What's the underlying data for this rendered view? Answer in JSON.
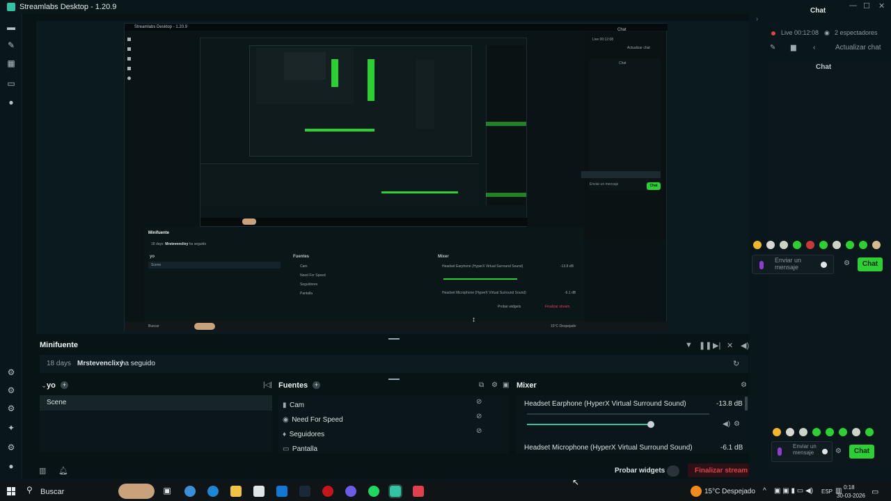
{
  "titlebar": {
    "title": "Streamlabs Desktop - 1.20.9",
    "min": "—",
    "max": "☐",
    "close": "✕"
  },
  "right_panel": {
    "header": "Chat",
    "live": "Live 00:12:08",
    "viewers": "2 espectadores",
    "update_chat": "Actualizar chat",
    "chat_title": "Chat",
    "send_placeholder": "Enviar un mensaje",
    "chat_button": "Chat"
  },
  "minifuente": {
    "title": "Minifuente",
    "event_days": "18 days",
    "event_user": "Mrstevenclixy",
    "event_action": "ha seguido"
  },
  "scenes": {
    "title": "yo",
    "items": [
      "Scene"
    ]
  },
  "sources": {
    "title": "Fuentes",
    "items": [
      "Cam",
      "Need For Speed",
      "Seguidores",
      "Pantalla"
    ]
  },
  "mixer": {
    "title": "Mixer",
    "tracks": [
      {
        "name": "Headset Earphone (HyperX Virtual Surround Sound)",
        "db": "-13.8 dB",
        "level": 0.68
      },
      {
        "name": "Headset Microphone (HyperX Virtual Surround Sound)",
        "db": "-6.1 dB",
        "level": 0.0
      }
    ]
  },
  "footer": {
    "test_widgets": "Probar widgets",
    "end_stream": "Finalizar stream"
  },
  "taskbar": {
    "search": "Buscar",
    "weather": "15°C Despejado",
    "lang": "ESP",
    "time": "0:18",
    "date": "30-03-2026"
  },
  "nested": {
    "title": "Streamlabs Desktop - 1.20.9",
    "chat": "Chat",
    "live": "Live 00:12:08",
    "update_chat": "Actualizar chat",
    "minifuente": "Minifuente",
    "event_days": "18 days",
    "event_user": "Mrstevenclixy",
    "event_action": "ha seguido",
    "scenes_title": "yo",
    "scene": "Scene",
    "sources_title": "Fuentes",
    "mixer_title": "Mixer",
    "src1": "Cam",
    "src2": "Need For Speed",
    "src3": "Seguidores",
    "src4": "Pantalla",
    "track1": "Headset Earphone (HyperX Virtual Surround Sound)",
    "db1": "-13.8 dB",
    "track2": "Headset Microphone (HyperX Virtual Surround Sound)",
    "db2": "-6.1 dB",
    "test_widgets": "Probar widgets",
    "end_stream": "Finalizar stream",
    "search": "Buscar",
    "weather": "15°C Despejado",
    "send": "Enviar un mensaje",
    "chat_btn": "Chat"
  },
  "colors": {
    "accent": "#31c3a2",
    "end_stream": "#e0414c",
    "chat_btn": "#2ecf34"
  }
}
